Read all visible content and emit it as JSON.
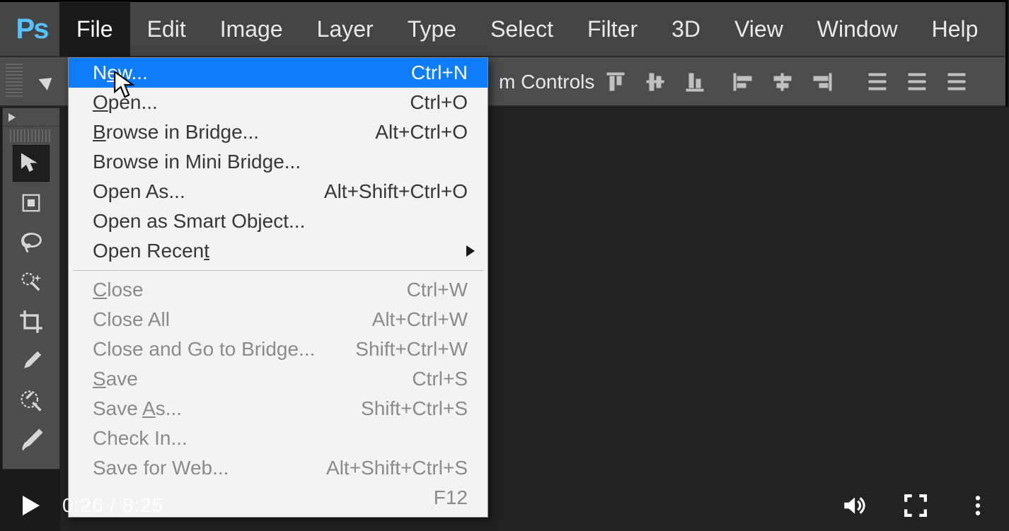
{
  "app": {
    "logo_text": "Ps"
  },
  "menubar": {
    "items": [
      "File",
      "Edit",
      "Image",
      "Layer",
      "Type",
      "Select",
      "Filter",
      "3D",
      "View",
      "Window",
      "Help"
    ],
    "open_index": 0
  },
  "optionsbar": {
    "transform_controls_label": "m Controls"
  },
  "file_menu": {
    "groups": [
      [
        {
          "label_pre": "N",
          "label_und": "e",
          "label_post": "w...",
          "shortcut": "Ctrl+N",
          "highlight": true
        },
        {
          "label_pre": "",
          "label_und": "O",
          "label_post": "pen...",
          "shortcut": "Ctrl+O"
        },
        {
          "label_pre": "",
          "label_und": "B",
          "label_post": "rowse in Bridge...",
          "shortcut": "Alt+Ctrl+O"
        },
        {
          "label_pre": "Browse in Mini Bridge...",
          "shortcut": ""
        },
        {
          "label_pre": "Open As...",
          "shortcut": "Alt+Shift+Ctrl+O"
        },
        {
          "label_pre": "Open as Smart Object...",
          "shortcut": ""
        },
        {
          "label_pre": "Open Recen",
          "label_und": "t",
          "label_post": "",
          "shortcut": "",
          "submenu": true
        }
      ],
      [
        {
          "label_pre": "",
          "label_und": "C",
          "label_post": "lose",
          "shortcut": "Ctrl+W",
          "disabled": true
        },
        {
          "label_pre": "Close All",
          "shortcut": "Alt+Ctrl+W",
          "disabled": true
        },
        {
          "label_pre": "Close and Go to Bridge...",
          "shortcut": "Shift+Ctrl+W",
          "disabled": true
        },
        {
          "label_pre": "",
          "label_und": "S",
          "label_post": "ave",
          "shortcut": "Ctrl+S",
          "disabled": true
        },
        {
          "label_pre": "Save ",
          "label_und": "A",
          "label_post": "s...",
          "shortcut": "Shift+Ctrl+S",
          "disabled": true
        },
        {
          "label_pre": "Check In...",
          "shortcut": "",
          "disabled": true
        },
        {
          "label_pre": "Save for Web...",
          "shortcut": "Alt+Shift+Ctrl+S",
          "disabled": true
        },
        {
          "label_pre": "",
          "shortcut": "F12",
          "disabled": true
        }
      ]
    ]
  },
  "video": {
    "elapsed": "0:26",
    "duration": "8:25",
    "sep": " / "
  }
}
